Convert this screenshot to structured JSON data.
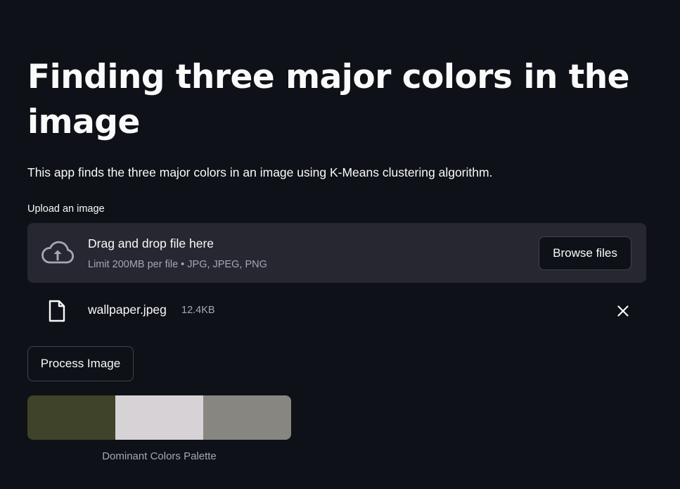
{
  "page": {
    "title": "Finding three major colors in the image",
    "description": "This app finds the three major colors in an image using K-Means clustering algorithm."
  },
  "uploader": {
    "label": "Upload an image",
    "drop_text": "Drag and drop file here",
    "limit_text": "Limit 200MB per file • JPG, JPEG, PNG",
    "browse_label": "Browse files",
    "icon": "cloud-upload-icon"
  },
  "uploaded_file": {
    "name": "wallpaper.jpeg",
    "size": "12.4KB",
    "icon": "file-icon",
    "remove_icon": "close-icon"
  },
  "actions": {
    "process_label": "Process Image"
  },
  "palette": {
    "caption": "Dominant Colors Palette",
    "colors": [
      "#3f4329",
      "#d6d2d6",
      "#878680"
    ]
  },
  "theme": {
    "background": "#0e1117",
    "surface": "#262730",
    "text": "#fafafa",
    "muted_text": "#a3a8b8"
  }
}
